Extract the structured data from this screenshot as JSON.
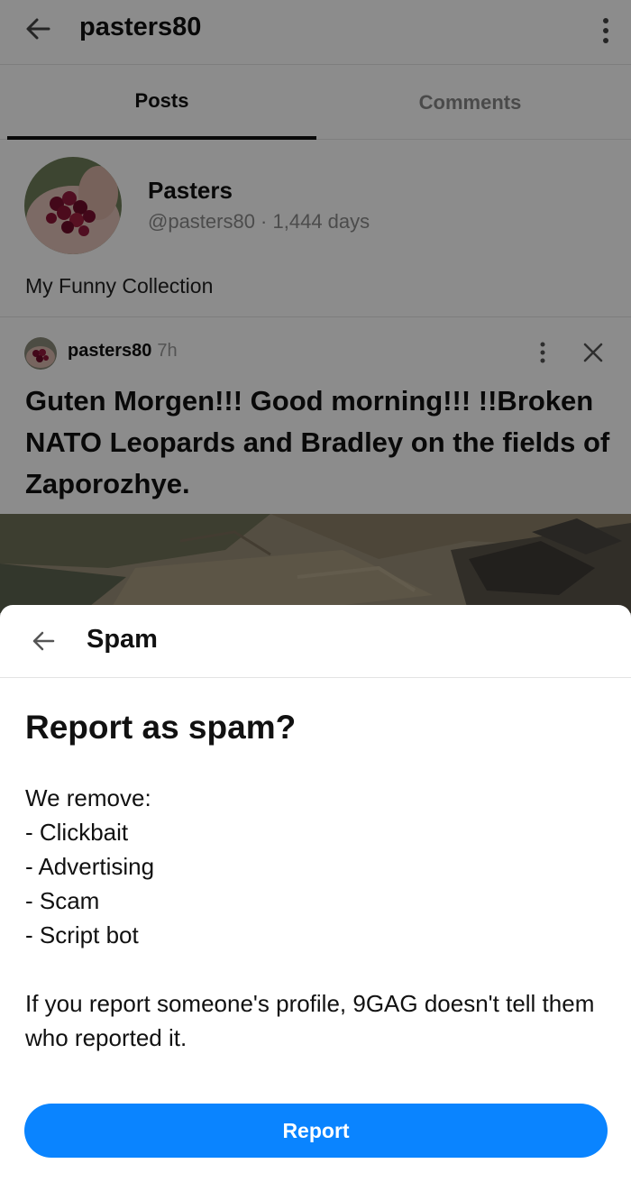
{
  "header": {
    "title": "pasters80"
  },
  "tabs": [
    {
      "label": "Posts",
      "active": true
    },
    {
      "label": "Comments",
      "active": false
    }
  ],
  "profile": {
    "name": "Pasters",
    "meta": "@pasters80 · 1,444 days",
    "bio": "My Funny Collection"
  },
  "post": {
    "username": "pasters80",
    "time": "7h",
    "title": "Guten Morgen!!! Good morning!!! !!Broken NATO Leopards and Bradley on the fields of Zaporozhye."
  },
  "sheet": {
    "title": "Spam",
    "heading": "Report as spam?",
    "intro": "We remove:",
    "items": [
      "- Clickbait",
      "- Advertising",
      "- Scam",
      "- Script bot"
    ],
    "note": "If you report someone's profile, 9GAG doesn't tell them who reported it.",
    "button_label": "Report"
  },
  "colors": {
    "accent": "#0a84ff",
    "overlay": "rgba(0,0,0,0.45)"
  },
  "icons": {
    "back": "arrow-left-icon",
    "menu": "vertical-dots-icon",
    "close": "close-icon"
  }
}
